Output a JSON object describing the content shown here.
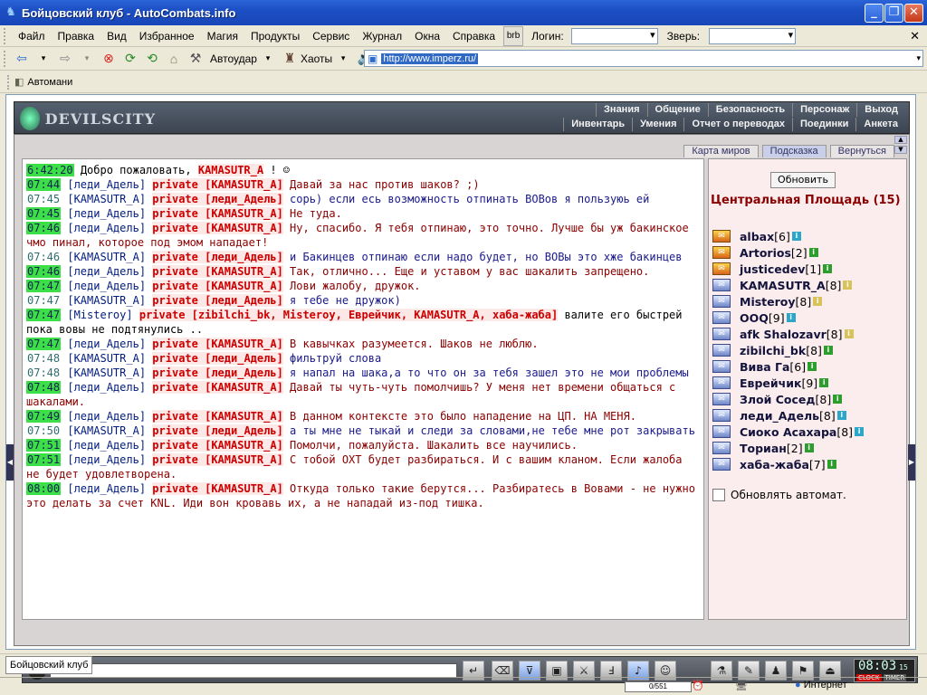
{
  "window": {
    "title": "Бойцовский клуб - AutoCombats.info"
  },
  "menu": {
    "items": [
      "Файл",
      "Правка",
      "Вид",
      "Избранное",
      "Магия",
      "Продукты",
      "Сервис",
      "Журнал",
      "Окна",
      "Справка"
    ],
    "login_label": "Логин:",
    "beast_label": "Зверь:"
  },
  "toolbar": {
    "autostrike": "Автоудар",
    "chaos": "Хаоты",
    "address": "http://www.imperz.ru/"
  },
  "links": {
    "automan": "Автомани"
  },
  "game": {
    "logo": "DEVILSCITY",
    "nav_top": [
      "Знания",
      "Общение",
      "Безопасность",
      "Персонаж",
      "Выход"
    ],
    "nav_bottom": [
      "Инвентарь",
      "Умения",
      "Отчет о переводах",
      "Поединки",
      "Анкета"
    ],
    "subtabs": [
      "Карта миров",
      "Подсказка",
      "Вернуться"
    ]
  },
  "chat": {
    "lines": [
      {
        "time": "6:42:20",
        "hl": true,
        "parts": [
          {
            "c": "msg-k",
            "t": "Добро пожаловать, "
          },
          {
            "c": "priv",
            "t": "KAMASUTR_A"
          },
          {
            "c": "msg-k",
            "t": "! ☺"
          }
        ]
      },
      {
        "time": "07:44",
        "hl": true,
        "parts": [
          {
            "c": "nick",
            "t": "[леди_Адель]"
          },
          {
            "c": "priv",
            "t": "private [KAMASUTR_A]"
          },
          {
            "c": "msg-r",
            "t": "Давай за нас против шаков? ;)"
          }
        ]
      },
      {
        "time": "07:45",
        "hl": false,
        "parts": [
          {
            "c": "nick",
            "t": "[KAMASUTR_A]"
          },
          {
            "c": "priv",
            "t": "private [леди_Адель]"
          },
          {
            "c": "msg-b",
            "t": "сорь) если есь возможность отпинать ВОВов я пользуюь ей"
          }
        ]
      },
      {
        "time": "07:45",
        "hl": true,
        "parts": [
          {
            "c": "nick",
            "t": "[леди_Адель]"
          },
          {
            "c": "priv",
            "t": "private [KAMASUTR_A]"
          },
          {
            "c": "msg-r",
            "t": "Не туда."
          }
        ]
      },
      {
        "time": "07:46",
        "hl": true,
        "parts": [
          {
            "c": "nick",
            "t": "[леди_Адель]"
          },
          {
            "c": "priv",
            "t": "private [KAMASUTR_A]"
          },
          {
            "c": "msg-r",
            "t": "Ну, спасибо. Я тебя отпинаю, это точно. Лучше бы уж бакинское чмо пинал, которое под эмом нападает!"
          }
        ]
      },
      {
        "time": "07:46",
        "hl": false,
        "parts": [
          {
            "c": "nick",
            "t": "[KAMASUTR_A]"
          },
          {
            "c": "priv",
            "t": "private [леди_Адель]"
          },
          {
            "c": "msg-b",
            "t": "и Бакинцев отпинаю если надо будет, но ВОВы это хже бакинцев"
          }
        ]
      },
      {
        "time": "07:46",
        "hl": true,
        "parts": [
          {
            "c": "nick",
            "t": "[леди_Адель]"
          },
          {
            "c": "priv",
            "t": "private [KAMASUTR_A]"
          },
          {
            "c": "msg-r",
            "t": "Так, отлично... Еще и уставом у вас шакалить запрещено."
          }
        ]
      },
      {
        "time": "07:47",
        "hl": true,
        "parts": [
          {
            "c": "nick",
            "t": "[леди_Адель]"
          },
          {
            "c": "priv",
            "t": "private [KAMASUTR_A]"
          },
          {
            "c": "msg-r",
            "t": "Лови жалобу, дружок."
          }
        ]
      },
      {
        "time": "07:47",
        "hl": false,
        "parts": [
          {
            "c": "nick",
            "t": "[KAMASUTR_A]"
          },
          {
            "c": "priv",
            "t": "private [леди_Адель]"
          },
          {
            "c": "msg-b",
            "t": "я тебе не дружок)"
          }
        ]
      },
      {
        "time": "07:47",
        "hl": true,
        "parts": [
          {
            "c": "nick",
            "t": "[Misteroy]"
          },
          {
            "c": "priv",
            "t": "private [zibilchi_bk, Misteroy, Еврейчик, KAMASUTR_A, хаба-жаба]"
          },
          {
            "c": "msg-k",
            "t": "валите его быстрей пока вовы не подтянулись .."
          }
        ]
      },
      {
        "time": "07:47",
        "hl": true,
        "parts": [
          {
            "c": "nick",
            "t": "[леди_Адель]"
          },
          {
            "c": "priv",
            "t": "private [KAMASUTR_A]"
          },
          {
            "c": "msg-r",
            "t": "В кавычках разумеется. Шаков не люблю."
          }
        ]
      },
      {
        "time": "07:48",
        "hl": false,
        "parts": [
          {
            "c": "nick",
            "t": "[KAMASUTR_A]"
          },
          {
            "c": "priv",
            "t": "private [леди_Адель]"
          },
          {
            "c": "msg-b",
            "t": "фильтруй слова"
          }
        ]
      },
      {
        "time": "07:48",
        "hl": false,
        "parts": [
          {
            "c": "nick",
            "t": "[KAMASUTR_A]"
          },
          {
            "c": "priv",
            "t": "private [леди_Адель]"
          },
          {
            "c": "msg-b",
            "t": "я напал на шака,а то что он за тебя зашел это не мои проблемы"
          }
        ]
      },
      {
        "time": "07:48",
        "hl": true,
        "parts": [
          {
            "c": "nick",
            "t": "[леди_Адель]"
          },
          {
            "c": "priv",
            "t": "private [KAMASUTR_A]"
          },
          {
            "c": "msg-r",
            "t": "Давай ты чуть-чуть помолчишь? У меня нет времени общаться с шакалами."
          }
        ]
      },
      {
        "time": "07:49",
        "hl": true,
        "parts": [
          {
            "c": "nick",
            "t": "[леди_Адель]"
          },
          {
            "c": "priv",
            "t": "private [KAMASUTR_A]"
          },
          {
            "c": "msg-r",
            "t": "В данном контексте это было нападение на ЦП. НА МЕНЯ."
          }
        ]
      },
      {
        "time": "07:50",
        "hl": false,
        "parts": [
          {
            "c": "nick",
            "t": "[KAMASUTR_A]"
          },
          {
            "c": "priv",
            "t": "private [леди_Адель]"
          },
          {
            "c": "msg-b",
            "t": "а ты мне не тыкай и следи за словами,не тебе мне рот закрывать"
          }
        ]
      },
      {
        "time": "07:51",
        "hl": true,
        "parts": [
          {
            "c": "nick",
            "t": "[леди_Адель]"
          },
          {
            "c": "priv",
            "t": "private [KAMASUTR_A]"
          },
          {
            "c": "msg-r",
            "t": "Помолчи, пожалуйста. Шакалить все научились."
          }
        ]
      },
      {
        "time": "07:51",
        "hl": true,
        "parts": [
          {
            "c": "nick",
            "t": "[леди_Адель]"
          },
          {
            "c": "priv",
            "t": "private [KAMASUTR_A]"
          },
          {
            "c": "msg-r",
            "t": "С тобой ОХТ будет разбираться. И с вашим кланом. Если жалоба не будет удовлетворена."
          }
        ]
      },
      {
        "time": "08:00",
        "hl": true,
        "parts": [
          {
            "c": "nick",
            "t": "[леди_Адель]"
          },
          {
            "c": "priv",
            "t": "private [KAMASUTR_A]"
          },
          {
            "c": "msg-r",
            "t": "Откуда только такие берутся... Разбиратесь в Вовами - не нужно это делать за счет KNL. Иди вон кровавь их, а не нападай из-под тишка."
          }
        ]
      }
    ]
  },
  "sidebar": {
    "refresh": "Обновить",
    "location": "Центральная Площадь (15)",
    "users": [
      {
        "name": "albax",
        "lvl": "[6]"
      },
      {
        "name": "Artorios",
        "lvl": "[2]"
      },
      {
        "name": "justicedev",
        "lvl": "[1]"
      },
      {
        "name": "KAMASUTR_A",
        "lvl": "[8]"
      },
      {
        "name": "Misteroy",
        "lvl": "[8]"
      },
      {
        "name": "OOQ",
        "lvl": "[9]"
      },
      {
        "name": "afk Shalozavr",
        "lvl": "[8]"
      },
      {
        "name": "zibilchi_bk",
        "lvl": "[8]"
      },
      {
        "name": "Вива Га",
        "lvl": "[6]"
      },
      {
        "name": "Еврейчик",
        "lvl": "[9]"
      },
      {
        "name": "Злой Сосед",
        "lvl": "[8]"
      },
      {
        "name": "леди_Адель",
        "lvl": "[8]"
      },
      {
        "name": "Сиоко Асахара",
        "lvl": "[8]"
      },
      {
        "name": "Ториан",
        "lvl": "[2]"
      },
      {
        "name": "хаба-жаба",
        "lvl": "[7]"
      }
    ],
    "auto_update": "Обновлять автомат."
  },
  "clock": {
    "time": "08:03",
    "sec": "15",
    "clock_label": "CLOCK",
    "timer_label": "TIMER"
  },
  "taskbar": {
    "item": "Бойцовский клуб"
  },
  "status": {
    "progress": "0/551",
    "zone": "Интернет"
  }
}
